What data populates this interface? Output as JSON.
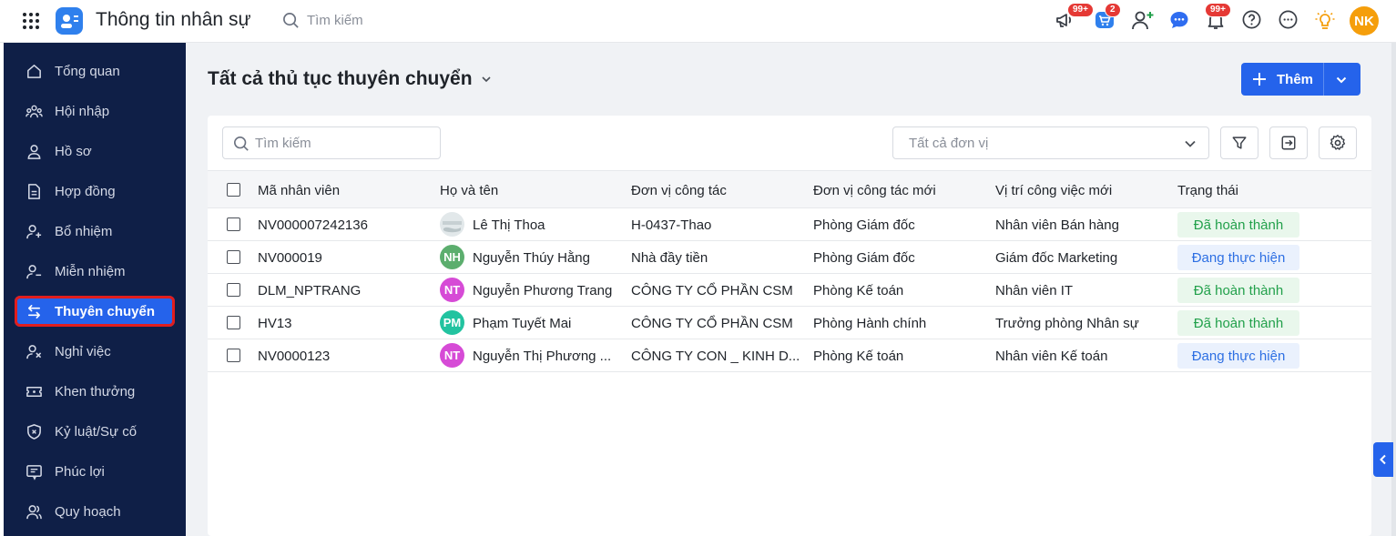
{
  "app": {
    "title": "Thông tin nhân sự",
    "search_placeholder": "Tìm kiếm",
    "avatar_initials": "NK",
    "accent": "#2563eb"
  },
  "top_icons": [
    {
      "name": "megaphone-icon",
      "badge": "99+"
    },
    {
      "name": "cart-icon",
      "badge": "2"
    },
    {
      "name": "add-user-icon",
      "badge": ""
    },
    {
      "name": "chat-icon",
      "badge": ""
    },
    {
      "name": "bell-icon",
      "badge": "99+"
    },
    {
      "name": "help-icon",
      "badge": ""
    },
    {
      "name": "more-icon",
      "badge": ""
    },
    {
      "name": "idea-icon",
      "badge": ""
    }
  ],
  "sidebar": {
    "items": [
      {
        "label": "Tổng quan",
        "icon": "home-icon"
      },
      {
        "label": "Hội nhập",
        "icon": "team-icon"
      },
      {
        "label": "Hồ sơ",
        "icon": "user-icon"
      },
      {
        "label": "Hợp đồng",
        "icon": "document-icon"
      },
      {
        "label": "Bổ nhiệm",
        "icon": "user-plus-icon"
      },
      {
        "label": "Miễn nhiệm",
        "icon": "user-minus-icon"
      },
      {
        "label": "Thuyên chuyển",
        "icon": "transfer-icon",
        "active": true
      },
      {
        "label": "Nghỉ việc",
        "icon": "user-x-icon"
      },
      {
        "label": "Khen thưởng",
        "icon": "ticket-icon"
      },
      {
        "label": "Kỷ luật/Sự cố",
        "icon": "shield-x-icon"
      },
      {
        "label": "Phúc lợi",
        "icon": "gift-card-icon"
      },
      {
        "label": "Quy hoạch",
        "icon": "users-icon"
      }
    ]
  },
  "page": {
    "title": "Tất cả thủ tục thuyên chuyển",
    "add_label": "Thêm"
  },
  "filters": {
    "search_placeholder": "Tìm kiếm",
    "unit_placeholder": "Tất cả đơn vị"
  },
  "table": {
    "headers": [
      "Mã nhân viên",
      "Họ và tên",
      "Đơn vị công tác",
      "Đơn vị công tác mới",
      "Vị trí công việc mới",
      "Trạng thái"
    ],
    "rows": [
      {
        "code": "NV000007242136",
        "initials": "",
        "avatar_color": "#cfd8dc",
        "name": "Lê Thị Thoa",
        "unit": "H-0437-Thao",
        "new_unit": "Phòng Giám đốc",
        "new_position": "Nhân viên Bán hàng",
        "status": "Đã hoàn thành",
        "status_type": "done"
      },
      {
        "code": "NV000019",
        "initials": "NH",
        "avatar_color": "#5cae6e",
        "name": "Nguyễn Thúy Hằng",
        "unit": "Nhà đầy tiền",
        "new_unit": "Phòng Giám đốc",
        "new_position": "Giám đốc Marketing",
        "status": "Đang thực hiện",
        "status_type": "prog"
      },
      {
        "code": "DLM_NPTRANG",
        "initials": "NT",
        "avatar_color": "#d64bd6",
        "name": "Nguyễn Phương Trang",
        "unit": "CÔNG TY CỔ PHẦN CSM",
        "new_unit": "Phòng Kế toán",
        "new_position": "Nhân viên IT",
        "status": "Đã hoàn thành",
        "status_type": "done"
      },
      {
        "code": "HV13",
        "initials": "PM",
        "avatar_color": "#22c3a0",
        "name": "Phạm Tuyết Mai",
        "unit": "CÔNG TY CỔ PHẦN CSM",
        "new_unit": "Phòng Hành chính",
        "new_position": "Trưởng phòng Nhân sự",
        "status": "Đã hoàn thành",
        "status_type": "done"
      },
      {
        "code": "NV0000123",
        "initials": "NT",
        "avatar_color": "#d64bd6",
        "name": "Nguyễn Thị Phương ...",
        "unit": "CÔNG TY CON _ KINH D...",
        "new_unit": "Phòng Kế toán",
        "new_position": "Nhân viên Kế toán",
        "status": "Đang thực hiện",
        "status_type": "prog"
      }
    ]
  }
}
